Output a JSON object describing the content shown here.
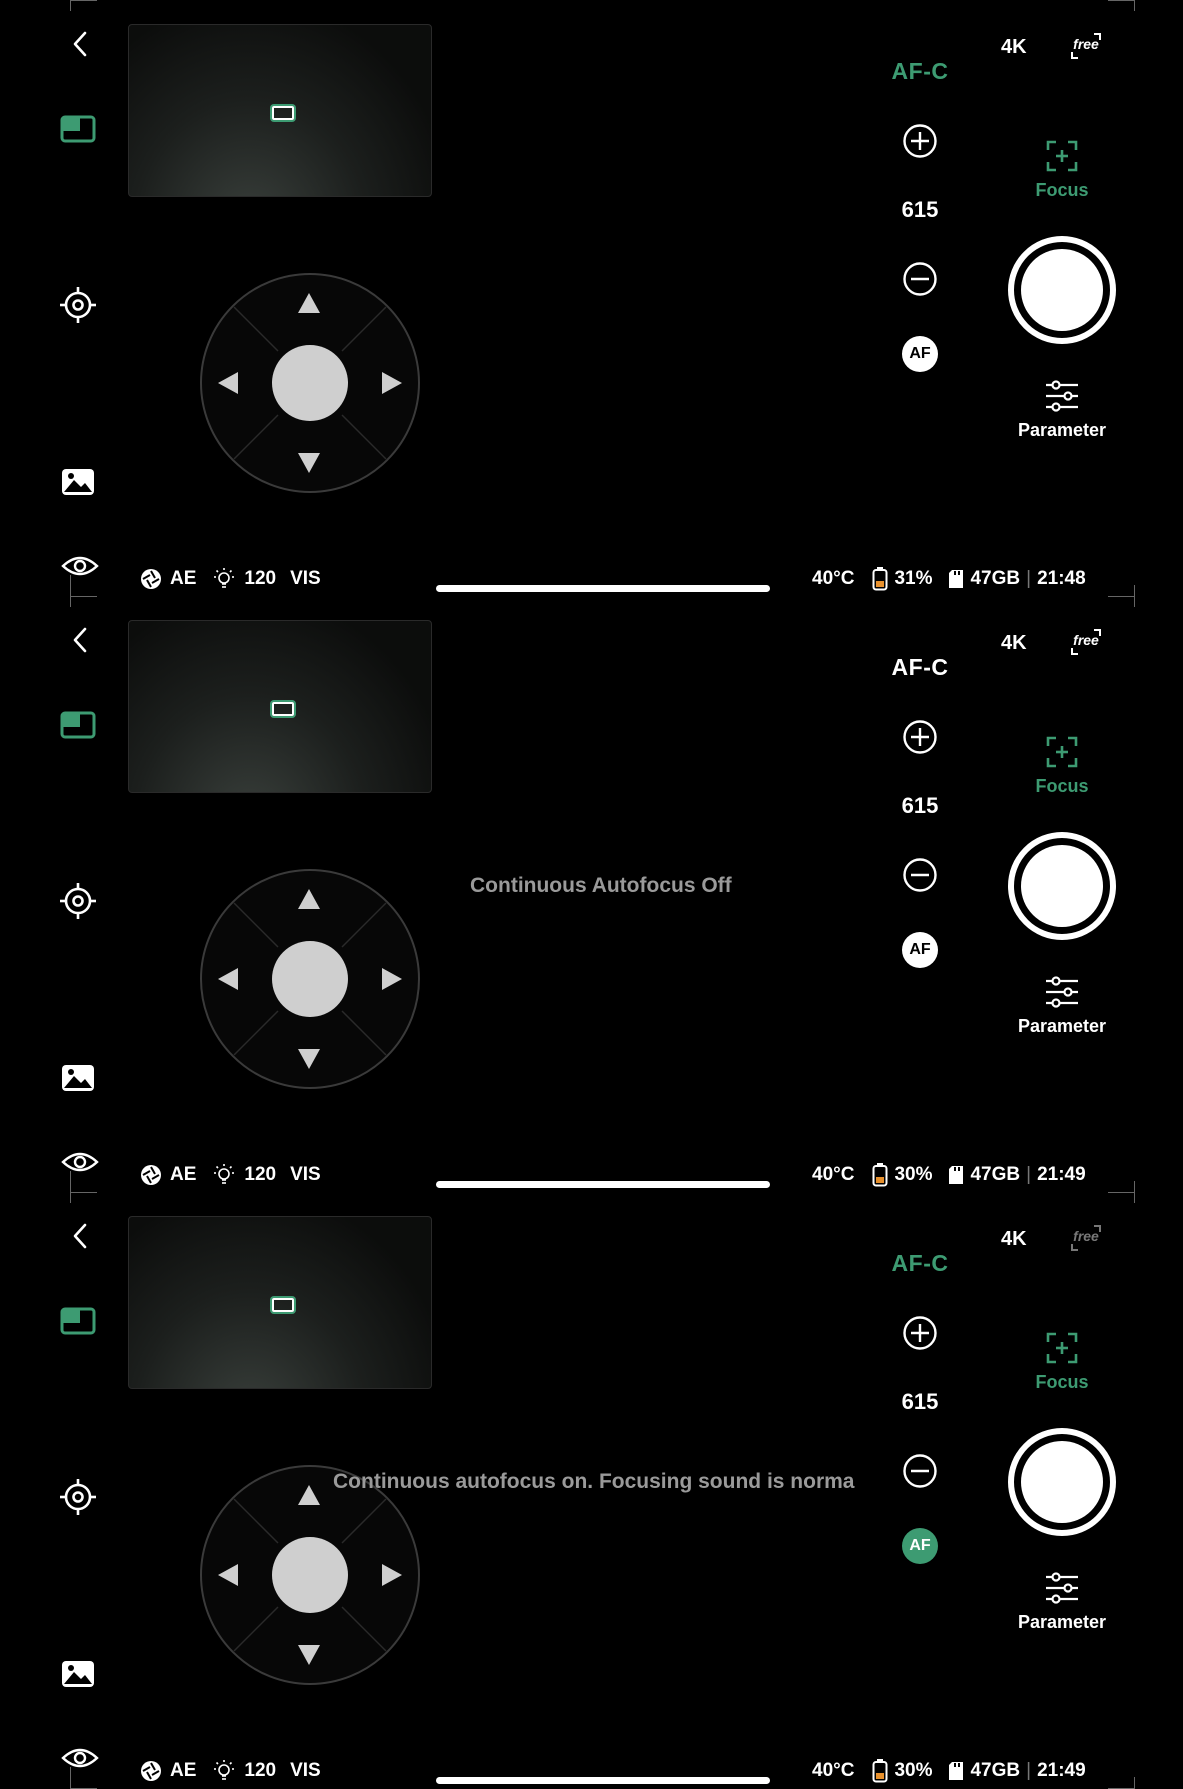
{
  "colors": {
    "accent": "#3d9b72",
    "background": "#000000",
    "text": "#ffffff",
    "muted": "#9a9a9a"
  },
  "panels": [
    {
      "af_mode": "AF-C",
      "af_mode_color": "#3d9b72",
      "resolution": "4K",
      "free_label": "free",
      "free_active": true,
      "zoom_value": "615",
      "af_button": "AF",
      "af_on": false,
      "focus_label": "Focus",
      "parameter_label": "Parameter",
      "toast": "",
      "status": {
        "exposure": "AE",
        "light": "120",
        "mode": "VIS",
        "temperature": "40°C",
        "battery": "31%",
        "storage": "47GB",
        "time": "21:48"
      }
    },
    {
      "af_mode": "AF-C",
      "af_mode_color": "#ffffff",
      "resolution": "4K",
      "free_label": "free",
      "free_active": true,
      "zoom_value": "615",
      "af_button": "AF",
      "af_on": false,
      "focus_label": "Focus",
      "parameter_label": "Parameter",
      "toast": "Continuous Autofocus Off",
      "status": {
        "exposure": "AE",
        "light": "120",
        "mode": "VIS",
        "temperature": "40°C",
        "battery": "30%",
        "storage": "47GB",
        "time": "21:49"
      }
    },
    {
      "af_mode": "AF-C",
      "af_mode_color": "#3d9b72",
      "resolution": "4K",
      "free_label": "free",
      "free_active": false,
      "zoom_value": "615",
      "af_button": "AF",
      "af_on": true,
      "focus_label": "Focus",
      "parameter_label": "Parameter",
      "toast": "Continuous autofocus on. Focusing sound is norma",
      "status": {
        "exposure": "AE",
        "light": "120",
        "mode": "VIS",
        "temperature": "40°C",
        "battery": "30%",
        "storage": "47GB",
        "time": "21:49"
      }
    }
  ],
  "icons": {
    "back": "chevron-left-icon",
    "pip": "picture-in-picture-icon",
    "target": "target-icon",
    "gallery": "gallery-icon",
    "eye": "eye-icon",
    "zoom_in": "plus-circle-icon",
    "zoom_out": "minus-circle-icon",
    "focus": "focus-frame-icon",
    "parameter": "sliders-icon",
    "aperture": "aperture-icon",
    "bulb": "light-bulb-icon",
    "battery": "battery-icon",
    "sd": "sd-card-icon"
  }
}
